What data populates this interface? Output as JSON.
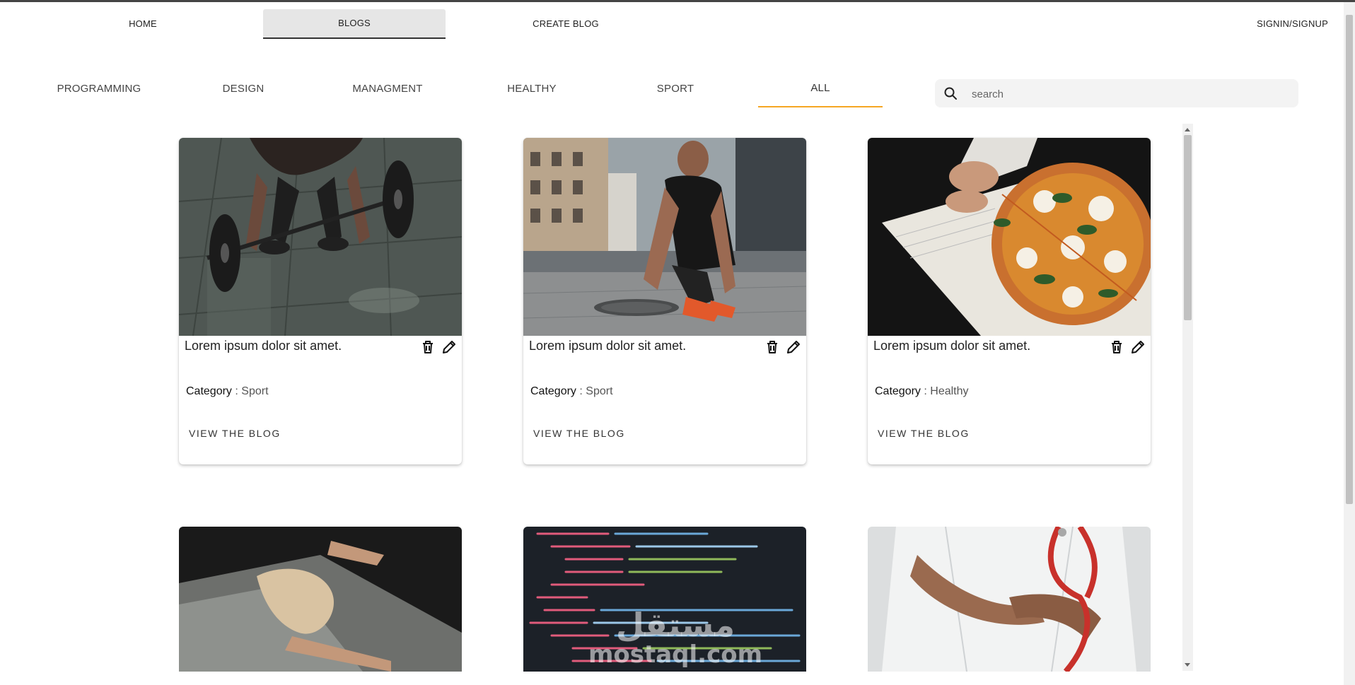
{
  "topnav": {
    "home": "HOME",
    "blogs": "BLOGS",
    "create": "CREATE BLOG",
    "signin": "SIGNIN/SIGNUP"
  },
  "categories": {
    "programming": "PROGRAMMING",
    "design": "DESIGN",
    "managment": "MANAGMENT",
    "healthy": "HEALTHY",
    "sport": "SPORT",
    "all": "ALL",
    "active": "ALL",
    "active_color": "#f5a623"
  },
  "search": {
    "placeholder": "search",
    "value": ""
  },
  "cards": [
    {
      "title": "Lorem ipsum dolor sit amet.",
      "category_label": "Category",
      "sep": " : ",
      "category": "Sport",
      "view": "VIEW THE BLOG",
      "image": "weightlifting-photo"
    },
    {
      "title": "Lorem ipsum dolor sit amet.",
      "category_label": "Category",
      "sep": " : ",
      "category": "Sport",
      "view": "VIEW THE BLOG",
      "image": "runner-tying-shoe-photo"
    },
    {
      "title": "Lorem ipsum dolor sit amet.",
      "category_label": "Category",
      "sep": " : ",
      "category": "Healthy",
      "view": "VIEW THE BLOG",
      "image": "pizza-photo"
    }
  ],
  "bottom_cards": [
    {
      "image": "hands-dough-photo"
    },
    {
      "image": "code-screen-photo"
    },
    {
      "image": "doctor-stethoscope-photo"
    }
  ],
  "watermark": {
    "arabic": "مستقل",
    "latin": "mostaql.com"
  },
  "icons": {
    "delete": "trash-icon",
    "edit": "pencil-icon",
    "search": "search-icon"
  }
}
